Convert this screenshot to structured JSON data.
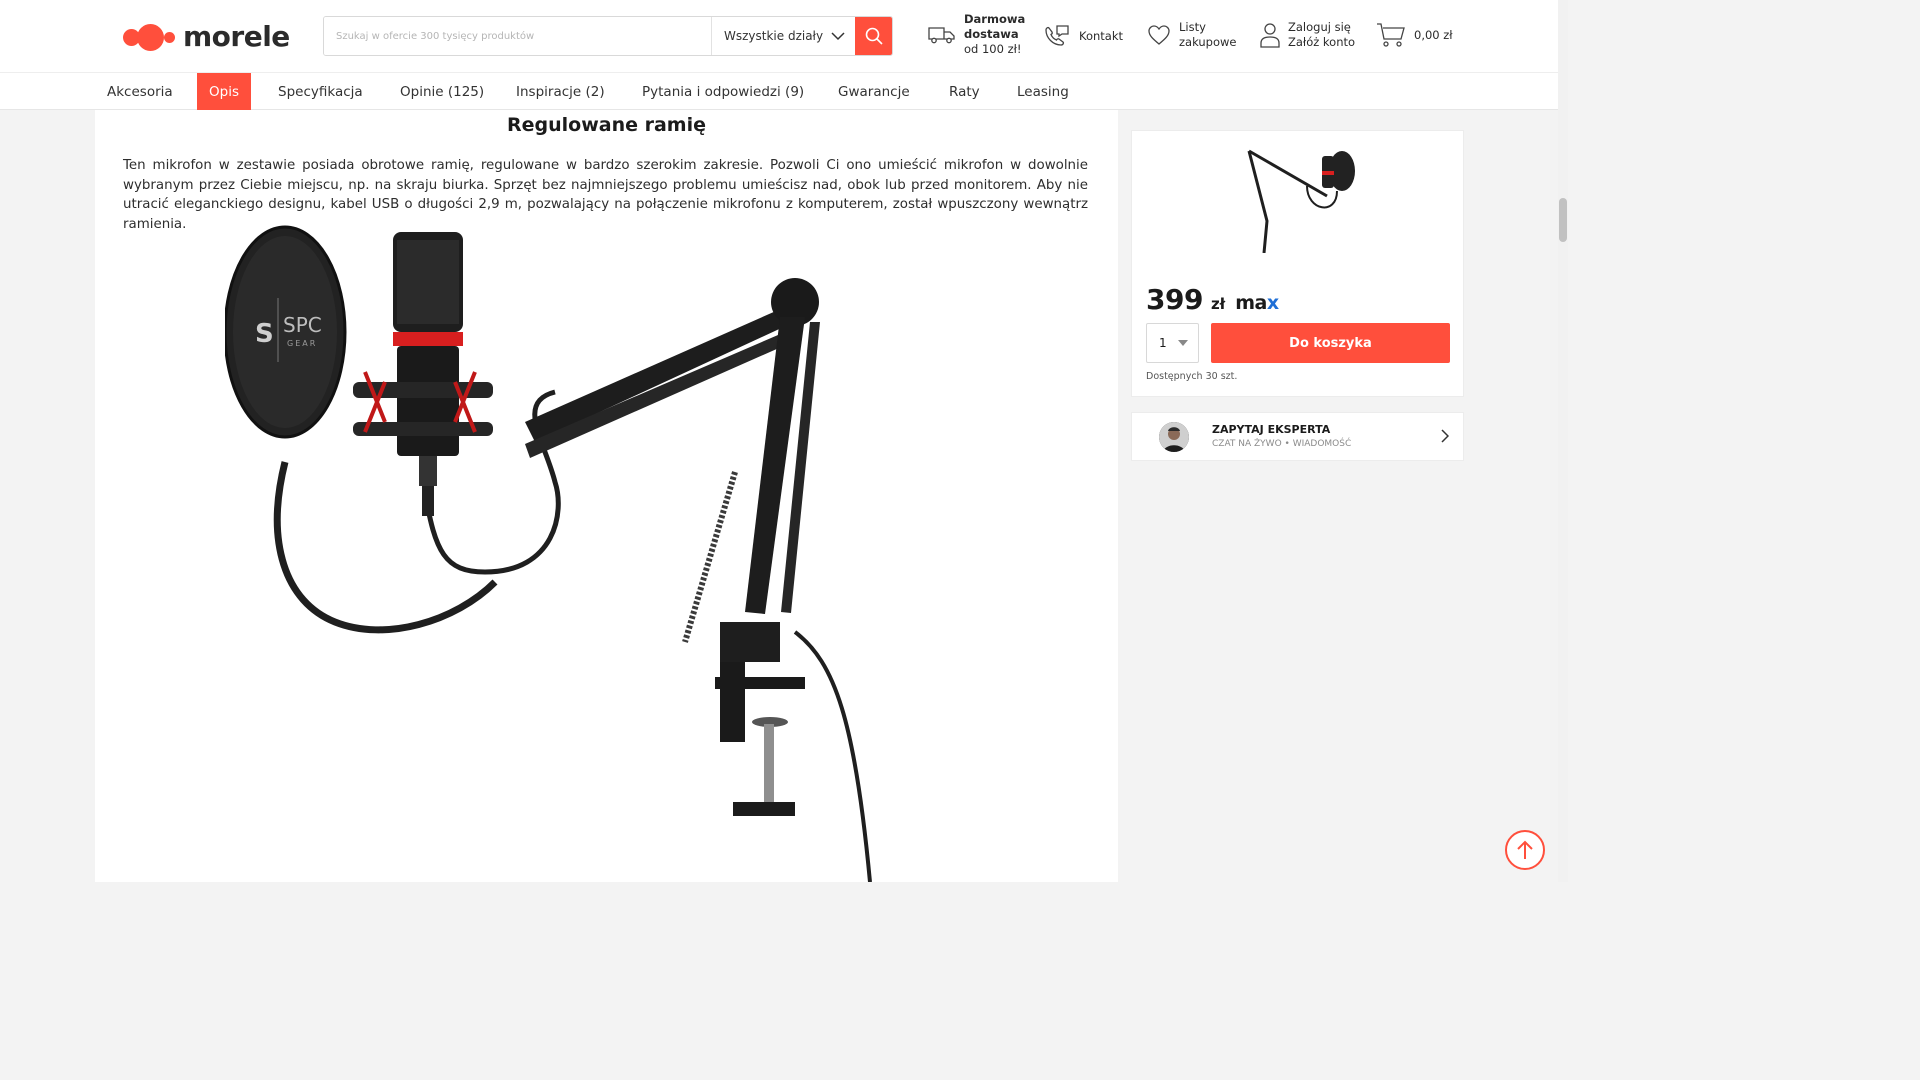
{
  "header": {
    "logo_text": "morele",
    "search": {
      "placeholder": "Szukaj w ofercie 300 tysięcy produktów",
      "category": "Wszystkie działy"
    },
    "delivery": {
      "line1": "Darmowa",
      "line2": "dostawa",
      "line3": "od 100 zł!"
    },
    "contact": "Kontakt",
    "lists": {
      "line1": "Listy",
      "line2": "zakupowe"
    },
    "account": {
      "line1": "Zaloguj się",
      "line2": "Załóż konto"
    },
    "cart_total": "0,00 zł"
  },
  "tabs": [
    {
      "label": "Akcesoria",
      "active": false
    },
    {
      "label": "Opis",
      "active": true
    },
    {
      "label": "Specyfikacja",
      "active": false
    },
    {
      "label": "Opinie (125)",
      "active": false
    },
    {
      "label": "Inspiracje (2)",
      "active": false
    },
    {
      "label": "Pytania i odpowiedzi (9)",
      "active": false
    },
    {
      "label": "Gwarancje",
      "active": false
    },
    {
      "label": "Raty",
      "active": false
    },
    {
      "label": "Leasing",
      "active": false
    }
  ],
  "content": {
    "title": "Regulowane ramię",
    "description": "Ten mikrofon w zestawie posiada obrotowe ramię, regulowane w bardzo szerokim zakresie. Pozwoli Ci ono umieścić mikrofon w dowolnie wybranym przez Ciebie miejscu, np. na skraju biurka. Sprzęt bez najmniejszego problemu umieścisz nad, obok lub przed monitorem. Aby nie utracić eleganckiego designu, kabel USB o długości 2,9 m, pozwalający na połączenie mikrofonu z komputerem, został wpuszczony wewnątrz ramienia.",
    "pop_filter_brand": "SPC",
    "pop_filter_sub": "GEAR"
  },
  "buybox": {
    "price": "399",
    "currency": "zł",
    "badge_m": "ma",
    "badge_x": "x",
    "quantity": "1",
    "add_to_cart": "Do koszyka",
    "availability": "Dostępnych 30 szt."
  },
  "expert": {
    "title": "ZAPYTAJ EKSPERTA",
    "subtitle": "CZAT NA ŻYWO • WIADOMOŚĆ"
  },
  "colors": {
    "accent": "#ff4f3c",
    "max_blue": "#1f6fd6"
  }
}
